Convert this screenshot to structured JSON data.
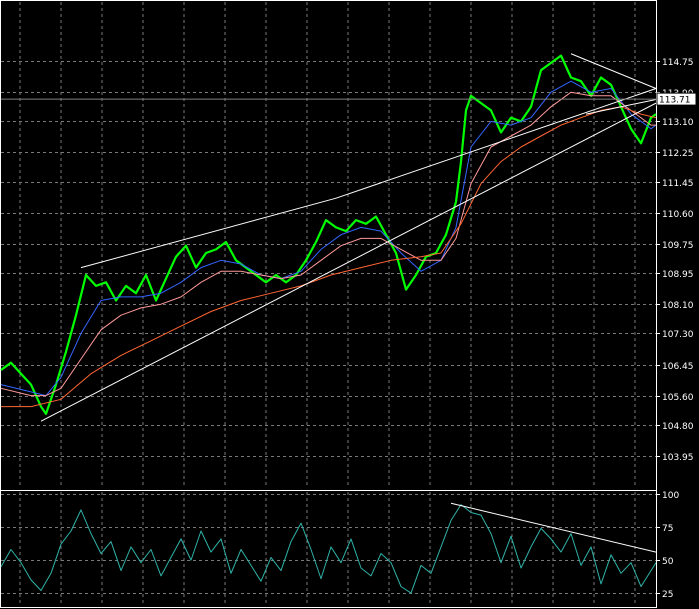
{
  "chart_data": [
    {
      "type": "line",
      "panel": "price",
      "ylim": [
        103.1,
        115.6
      ],
      "y_ticks": [
        "114.75",
        "113.90",
        "113.10",
        "112.25",
        "111.45",
        "110.60",
        "109.75",
        "108.95",
        "108.10",
        "107.30",
        "106.45",
        "105.60",
        "104.80",
        "103.95"
      ],
      "current_price_label": "113.71",
      "current_price": 113.71,
      "grid": true,
      "price_series_color": "#00ff00",
      "series": [
        {
          "color": "#00ff00",
          "x": [
            0,
            10,
            20,
            30,
            40,
            45,
            55,
            65,
            75,
            85,
            95,
            105,
            115,
            125,
            135,
            145,
            155,
            165,
            175,
            185,
            195,
            205,
            215,
            225,
            235,
            245,
            255,
            265,
            275,
            285,
            295,
            305,
            315,
            325,
            335,
            345,
            355,
            365,
            375,
            385,
            395,
            405,
            415,
            425,
            435,
            445,
            455,
            460,
            465,
            470,
            480,
            490,
            500,
            510,
            520,
            530,
            540,
            550,
            560,
            570,
            580,
            590,
            600,
            610,
            620,
            630,
            640,
            650,
            655
          ],
          "y": [
            106.3,
            106.5,
            106.2,
            105.9,
            105.3,
            105.1,
            105.9,
            106.8,
            107.8,
            108.9,
            108.6,
            108.7,
            108.2,
            108.6,
            108.4,
            108.9,
            108.2,
            108.8,
            109.4,
            109.7,
            109.1,
            109.5,
            109.6,
            109.8,
            109.3,
            109.1,
            108.9,
            108.7,
            108.9,
            108.7,
            108.9,
            109.3,
            109.8,
            110.4,
            110.2,
            110.1,
            110.4,
            110.3,
            110.5,
            110.0,
            109.5,
            108.5,
            108.9,
            109.4,
            109.5,
            110.0,
            110.9,
            112.0,
            113.4,
            113.8,
            113.6,
            113.4,
            112.8,
            113.2,
            113.1,
            113.5,
            114.5,
            114.7,
            114.9,
            114.3,
            114.2,
            113.8,
            114.3,
            114.1,
            113.5,
            112.9,
            112.5,
            113.2,
            113.3
          ]
        },
        {
          "color": "#3366ff",
          "x": [
            0,
            30,
            45,
            60,
            80,
            100,
            120,
            140,
            160,
            180,
            200,
            220,
            240,
            260,
            280,
            300,
            320,
            340,
            360,
            380,
            400,
            420,
            440,
            455,
            470,
            490,
            510,
            530,
            550,
            570,
            590,
            610,
            630,
            650,
            655
          ],
          "y": [
            105.9,
            105.7,
            105.6,
            106.1,
            107.3,
            108.2,
            108.3,
            108.3,
            108.4,
            108.7,
            109.1,
            109.3,
            109.2,
            108.9,
            108.8,
            109.0,
            109.6,
            110.0,
            110.2,
            110.1,
            109.5,
            109.0,
            109.3,
            110.2,
            112.4,
            113.1,
            113.0,
            113.2,
            113.9,
            114.2,
            113.9,
            114.0,
            113.3,
            112.9,
            113.0
          ]
        },
        {
          "color": "#ff9999",
          "x": [
            0,
            30,
            45,
            60,
            80,
            100,
            120,
            140,
            160,
            180,
            200,
            220,
            240,
            260,
            280,
            300,
            320,
            340,
            360,
            380,
            400,
            420,
            440,
            455,
            470,
            490,
            510,
            530,
            550,
            570,
            590,
            610,
            630,
            650,
            655
          ],
          "y": [
            105.8,
            105.6,
            105.6,
            105.8,
            106.6,
            107.4,
            107.8,
            108.0,
            108.1,
            108.3,
            108.7,
            109.0,
            109.0,
            108.9,
            108.8,
            108.9,
            109.3,
            109.7,
            109.9,
            109.9,
            109.6,
            109.3,
            109.3,
            109.9,
            111.4,
            112.4,
            112.7,
            113.0,
            113.5,
            113.9,
            113.8,
            113.8,
            113.4,
            113.0,
            113.0
          ]
        },
        {
          "color": "#ff6633",
          "x": [
            0,
            30,
            60,
            90,
            120,
            150,
            180,
            210,
            240,
            270,
            300,
            330,
            360,
            390,
            420,
            440,
            460,
            480,
            500,
            520,
            540,
            560,
            580,
            600,
            620,
            640,
            655
          ],
          "y": [
            105.3,
            105.3,
            105.5,
            106.2,
            106.7,
            107.1,
            107.5,
            107.9,
            108.2,
            108.4,
            108.6,
            108.9,
            109.1,
            109.3,
            109.4,
            109.5,
            110.3,
            111.4,
            112.0,
            112.4,
            112.7,
            113.0,
            113.2,
            113.4,
            113.5,
            113.3,
            113.2
          ]
        }
      ],
      "trendlines": [
        {
          "color": "#ffffff",
          "x": [
            80,
            335
          ],
          "y": [
            109.1,
            111.0
          ]
        },
        {
          "color": "#ffffff",
          "x": [
            40,
            655
          ],
          "y": [
            104.9,
            113.6
          ]
        },
        {
          "color": "#ffffff",
          "x": [
            335,
            655
          ],
          "y": [
            111.0,
            114.0
          ]
        },
        {
          "color": "#ffffff",
          "x": [
            570,
            655
          ],
          "y": [
            114.95,
            114.0
          ]
        },
        {
          "color": "#ffffff",
          "x": [
            585,
            655
          ],
          "y": [
            113.3,
            113.7
          ]
        }
      ]
    },
    {
      "type": "line",
      "panel": "oscillator",
      "ylim": [
        16,
        100
      ],
      "y_ticks": [
        "100",
        "75",
        "50",
        "25"
      ],
      "grid": true,
      "series": [
        {
          "color": "#2fb3a9",
          "x": [
            0,
            10,
            20,
            30,
            40,
            50,
            60,
            70,
            80,
            90,
            100,
            110,
            120,
            130,
            140,
            150,
            160,
            170,
            180,
            190,
            200,
            210,
            220,
            230,
            240,
            250,
            260,
            270,
            280,
            290,
            300,
            310,
            320,
            330,
            340,
            350,
            360,
            370,
            380,
            390,
            400,
            410,
            420,
            430,
            440,
            450,
            460,
            470,
            480,
            490,
            500,
            510,
            520,
            530,
            540,
            550,
            560,
            570,
            580,
            590,
            600,
            610,
            620,
            630,
            640,
            650,
            655
          ],
          "y": [
            45,
            58,
            48,
            35,
            27,
            40,
            62,
            72,
            88,
            70,
            55,
            64,
            42,
            60,
            48,
            58,
            38,
            52,
            66,
            50,
            72,
            56,
            66,
            40,
            58,
            46,
            34,
            52,
            42,
            64,
            78,
            58,
            36,
            60,
            48,
            66,
            44,
            38,
            55,
            48,
            30,
            25,
            46,
            40,
            60,
            80,
            92,
            86,
            84,
            70,
            48,
            68,
            44,
            60,
            74,
            66,
            56,
            70,
            46,
            60,
            32,
            54,
            40,
            48,
            30,
            42,
            48
          ]
        }
      ],
      "trendlines": [
        {
          "color": "#ffffff",
          "x": [
            450,
            655
          ],
          "y": [
            93,
            56
          ]
        }
      ]
    }
  ]
}
